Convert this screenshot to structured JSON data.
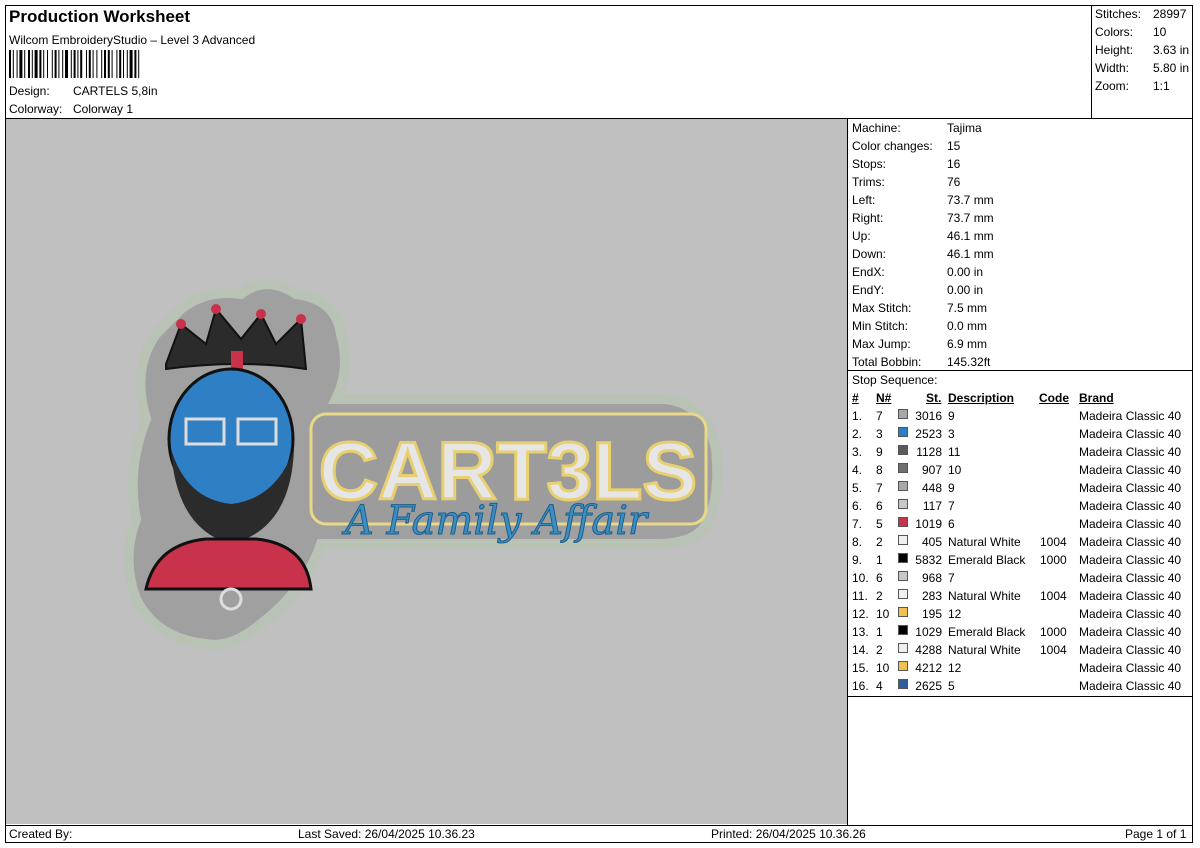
{
  "header": {
    "title": "Production Worksheet",
    "software": "Wilcom EmbroideryStudio – Level 3 Advanced",
    "design_label": "Design:",
    "design_value": "CARTELS 5,8in",
    "colorway_label": "Colorway:",
    "colorway_value": "Colorway 1"
  },
  "summary": [
    {
      "label": "Stitches:",
      "value": "28997"
    },
    {
      "label": "Colors:",
      "value": "10"
    },
    {
      "label": "Height:",
      "value": "3.63 in"
    },
    {
      "label": "Width:",
      "value": "5.80 in"
    },
    {
      "label": "Zoom:",
      "value": "1:1"
    }
  ],
  "machine_info": [
    {
      "label": "Machine:",
      "value": "Tajima"
    },
    {
      "label": "Color changes:",
      "value": "15"
    },
    {
      "label": "Stops:",
      "value": "16"
    },
    {
      "label": "Trims:",
      "value": "76"
    },
    {
      "label": "Left:",
      "value": "73.7 mm"
    },
    {
      "label": "Right:",
      "value": "73.7 mm"
    },
    {
      "label": "Up:",
      "value": "46.1 mm"
    },
    {
      "label": "Down:",
      "value": "46.1 mm"
    },
    {
      "label": "EndX:",
      "value": "0.00 in"
    },
    {
      "label": "EndY:",
      "value": "0.00 in"
    },
    {
      "label": "Max Stitch:",
      "value": "7.5 mm"
    },
    {
      "label": "Min Stitch:",
      "value": "0.0 mm"
    },
    {
      "label": "Max Jump:",
      "value": "6.9 mm"
    },
    {
      "label": "Total Bobbin:",
      "value": "145.32ft"
    }
  ],
  "stop_sequence": {
    "title": "Stop Sequence:",
    "columns": {
      "num": "#",
      "n": "N#",
      "st": "St.",
      "desc": "Description",
      "code": "Code",
      "brand": "Brand"
    },
    "rows": [
      {
        "num": "1.",
        "n": "7",
        "color": "#a8a8a8",
        "st": "3016",
        "desc": "9",
        "code": "",
        "brand": "Madeira Classic 40"
      },
      {
        "num": "2.",
        "n": "3",
        "color": "#2f7fc4",
        "st": "2523",
        "desc": "3",
        "code": "",
        "brand": "Madeira Classic 40"
      },
      {
        "num": "3.",
        "n": "9",
        "color": "#5a5a5a",
        "st": "1128",
        "desc": "11",
        "code": "",
        "brand": "Madeira Classic 40"
      },
      {
        "num": "4.",
        "n": "8",
        "color": "#6e6e6e",
        "st": "907",
        "desc": "10",
        "code": "",
        "brand": "Madeira Classic 40"
      },
      {
        "num": "5.",
        "n": "7",
        "color": "#a8a8a8",
        "st": "448",
        "desc": "9",
        "code": "",
        "brand": "Madeira Classic 40"
      },
      {
        "num": "6.",
        "n": "6",
        "color": "#c8c8c8",
        "st": "117",
        "desc": "7",
        "code": "",
        "brand": "Madeira Classic 40"
      },
      {
        "num": "7.",
        "n": "5",
        "color": "#c8324a",
        "st": "1019",
        "desc": "6",
        "code": "",
        "brand": "Madeira Classic 40"
      },
      {
        "num": "8.",
        "n": "2",
        "color": "#f0f0f0",
        "st": "405",
        "desc": "Natural White",
        "code": "1004",
        "brand": "Madeira Classic 40"
      },
      {
        "num": "9.",
        "n": "1",
        "color": "#000000",
        "st": "5832",
        "desc": "Emerald Black",
        "code": "1000",
        "brand": "Madeira Classic 40"
      },
      {
        "num": "10.",
        "n": "6",
        "color": "#c8c8c8",
        "st": "968",
        "desc": "7",
        "code": "",
        "brand": "Madeira Classic 40"
      },
      {
        "num": "11.",
        "n": "2",
        "color": "#f0f0f0",
        "st": "283",
        "desc": "Natural White",
        "code": "1004",
        "brand": "Madeira Classic 40"
      },
      {
        "num": "12.",
        "n": "10",
        "color": "#f0c050",
        "st": "195",
        "desc": "12",
        "code": "",
        "brand": "Madeira Classic 40"
      },
      {
        "num": "13.",
        "n": "1",
        "color": "#000000",
        "st": "1029",
        "desc": "Emerald Black",
        "code": "1000",
        "brand": "Madeira Classic 40"
      },
      {
        "num": "14.",
        "n": "2",
        "color": "#f0f0f0",
        "st": "4288",
        "desc": "Natural White",
        "code": "1004",
        "brand": "Madeira Classic 40"
      },
      {
        "num": "15.",
        "n": "10",
        "color": "#f0c050",
        "st": "4212",
        "desc": "12",
        "code": "",
        "brand": "Madeira Classic 40"
      },
      {
        "num": "16.",
        "n": "4",
        "color": "#2e5f9a",
        "st": "2625",
        "desc": "5",
        "code": "",
        "brand": "Madeira Classic 40"
      }
    ]
  },
  "design_preview": {
    "main_text": "CART3LS",
    "script_text": "A Family Affair",
    "background": "#c0c0c0"
  },
  "footer": {
    "created_by": "Created By:",
    "last_saved": "Last Saved: 26/04/2025 10.36.23",
    "printed": "Printed: 26/04/2025 10.36.26",
    "page": "Page 1 of 1"
  }
}
